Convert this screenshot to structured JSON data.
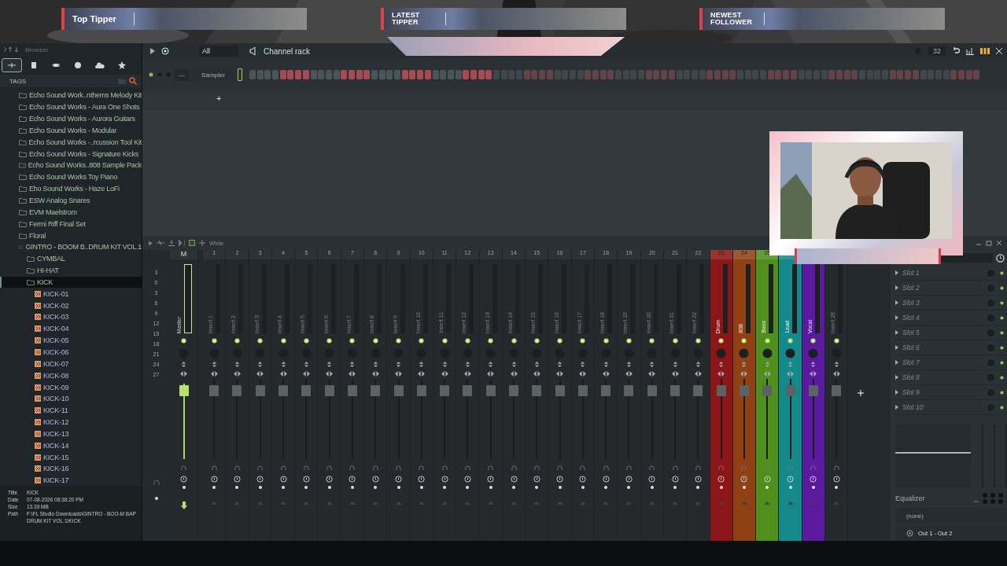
{
  "overlay": {
    "bars": [
      {
        "label": "Top Tipper",
        "kind": "single"
      },
      {
        "label": "LATEST TIPPER",
        "kind": "double"
      },
      {
        "label": "NEWEST FOLLOWER",
        "kind": "double"
      }
    ]
  },
  "browser": {
    "title": "Browser",
    "tabs": [
      {
        "selected": true
      },
      {
        "selected": false
      },
      {
        "selected": false
      },
      {
        "selected": false
      },
      {
        "selected": false
      },
      {
        "selected": false
      }
    ],
    "tags_label": "TAGS",
    "tree": [
      {
        "label": "Echo Sound Work..nthems Melody Kit",
        "kind": "folder",
        "selected": false
      },
      {
        "label": "Echo Sound Works - Aura One Shots",
        "kind": "folder",
        "selected": false
      },
      {
        "label": "Echo Sound Works - Aurora Guitars",
        "kind": "folder",
        "selected": false
      },
      {
        "label": "Echo Sound Works - Modular",
        "kind": "folder",
        "selected": false
      },
      {
        "label": "Echo Sound Works -..rcussion Tool Kit",
        "kind": "folder",
        "selected": false
      },
      {
        "label": "Echo Sound Works - Signature Kicks",
        "kind": "folder",
        "selected": false
      },
      {
        "label": "Echo Sound Works..808 Sample Pack",
        "kind": "folder",
        "selected": false
      },
      {
        "label": "Echo Sound Works Toy Piano",
        "kind": "folder",
        "selected": false
      },
      {
        "label": "Eho Sound Works - Haze LoFi",
        "kind": "folder",
        "selected": false
      },
      {
        "label": "ESW Analog Snares",
        "kind": "folder",
        "selected": false
      },
      {
        "label": "EVM Maelstrom",
        "kind": "folder",
        "selected": false
      },
      {
        "label": "Fermi Riff Final Set",
        "kind": "folder",
        "selected": false
      },
      {
        "label": "Floral",
        "kind": "folder",
        "selected": false
      },
      {
        "label": "GINTRO - BOOM B..DRUM KIT VOL.1",
        "kind": "folder",
        "selected": false,
        "children": [
          {
            "label": "CYMBAL",
            "kind": "folder",
            "selected": false
          },
          {
            "label": "HI-HAT",
            "kind": "folder",
            "selected": false
          },
          {
            "label": "KICK",
            "kind": "folder",
            "selected": true,
            "children": [
              {
                "label": "KICK-01",
                "kind": "file",
                "selected": false
              },
              {
                "label": "KICK-02",
                "kind": "file",
                "selected": false
              },
              {
                "label": "KICK-03",
                "kind": "file",
                "selected": false
              },
              {
                "label": "KICK-04",
                "kind": "file",
                "selected": false
              },
              {
                "label": "KICK-05",
                "kind": "file",
                "selected": false
              },
              {
                "label": "KICK-06",
                "kind": "file",
                "selected": false
              },
              {
                "label": "KICK-07",
                "kind": "file",
                "selected": false
              },
              {
                "label": "KICK-08",
                "kind": "file",
                "selected": false
              },
              {
                "label": "KICK-09",
                "kind": "file",
                "selected": false
              },
              {
                "label": "KICK-10",
                "kind": "file",
                "selected": false
              },
              {
                "label": "KICK-11",
                "kind": "file",
                "selected": false
              },
              {
                "label": "KICK-12",
                "kind": "file",
                "selected": false
              },
              {
                "label": "KICK-13",
                "kind": "file",
                "selected": false
              },
              {
                "label": "KICK-14",
                "kind": "file",
                "selected": false
              },
              {
                "label": "KICK-15",
                "kind": "file",
                "selected": false
              },
              {
                "label": "KICK-16",
                "kind": "file",
                "selected": false
              },
              {
                "label": "KICK-17",
                "kind": "file",
                "selected": false
              }
            ]
          }
        ]
      }
    ],
    "info": [
      {
        "label": "Title",
        "value": "KICK"
      },
      {
        "label": "Date",
        "value": "07-08-2026 08:38:20 PM"
      },
      {
        "label": "Size",
        "value": "13.39 MB"
      },
      {
        "label": "Path",
        "value": "F:\\FL Studio Downloads\\GINTRO - BOO-M BAP DRUM KIT VOL.1\\KICK"
      }
    ]
  },
  "channel_rack": {
    "filter": "All",
    "title": "Channel rack",
    "pattern_length": "32",
    "channel": {
      "name": "Sampler",
      "line": "---"
    },
    "steps": [
      false,
      false,
      false,
      false,
      true,
      true,
      true,
      true,
      false,
      false,
      false,
      false,
      true,
      true,
      true,
      true,
      false,
      false,
      false,
      false,
      true,
      true,
      true,
      true,
      false,
      false,
      false,
      false,
      true,
      true,
      true,
      true
    ],
    "add_label": "+"
  },
  "mixer": {
    "view": "Wide",
    "scale": [
      "3",
      "0",
      "3",
      "6",
      "9",
      "12",
      "15",
      "18",
      "21",
      "24",
      "27"
    ],
    "strips": [
      {
        "name": "Master",
        "number": "M",
        "kind": "master"
      },
      {
        "name": "Insert 1",
        "number": "1",
        "kind": "insert"
      },
      {
        "name": "Insert 2",
        "number": "2",
        "kind": "insert"
      },
      {
        "name": "Insert 3",
        "number": "3",
        "kind": "insert"
      },
      {
        "name": "Insert 4",
        "number": "4",
        "kind": "insert"
      },
      {
        "name": "Insert 5",
        "number": "5",
        "kind": "insert"
      },
      {
        "name": "Insert 6",
        "number": "6",
        "kind": "insert"
      },
      {
        "name": "Insert 7",
        "number": "7",
        "kind": "insert"
      },
      {
        "name": "Insert 8",
        "number": "8",
        "kind": "insert"
      },
      {
        "name": "Insert 9",
        "number": "9",
        "kind": "insert"
      },
      {
        "name": "Insert 10",
        "number": "10",
        "kind": "insert"
      },
      {
        "name": "Insert 11",
        "number": "11",
        "kind": "insert"
      },
      {
        "name": "Insert 12",
        "number": "12",
        "kind": "insert"
      },
      {
        "name": "Insert 13",
        "number": "13",
        "kind": "insert"
      },
      {
        "name": "Insert 14",
        "number": "14",
        "kind": "insert"
      },
      {
        "name": "Insert 15",
        "number": "15",
        "kind": "insert"
      },
      {
        "name": "Insert 16",
        "number": "16",
        "kind": "insert"
      },
      {
        "name": "Insert 17",
        "number": "17",
        "kind": "insert"
      },
      {
        "name": "Insert 18",
        "number": "18",
        "kind": "insert"
      },
      {
        "name": "Insert 19",
        "number": "19",
        "kind": "insert"
      },
      {
        "name": "Insert 20",
        "number": "20",
        "kind": "insert"
      },
      {
        "name": "Insert 21",
        "number": "21",
        "kind": "insert"
      },
      {
        "name": "Insert 22",
        "number": "22",
        "kind": "insert"
      },
      {
        "name": "Drum",
        "number": "23",
        "kind": "insert",
        "color": "#8c1616"
      },
      {
        "name": "808",
        "number": "24",
        "kind": "insert",
        "color": "#8f4114"
      },
      {
        "name": "Bass",
        "number": "25",
        "kind": "insert",
        "color": "#4f8f1c"
      },
      {
        "name": "Lead",
        "kind": "insert",
        "color": "#14898c"
      },
      {
        "name": "Vocal",
        "kind": "insert",
        "color": "#5b1a9e"
      },
      {
        "name": "Insert 28",
        "kind": "insert"
      }
    ],
    "slots": [
      "Slot 1",
      "Slot 2",
      "Slot 3",
      "Slot 4",
      "Slot 5",
      "Slot 6",
      "Slot 7",
      "Slot 8",
      "Slot 9",
      "Slot 10"
    ],
    "eq_label": "Equalizer",
    "input": "(none)",
    "output": "Out 1 - Out 2"
  }
}
